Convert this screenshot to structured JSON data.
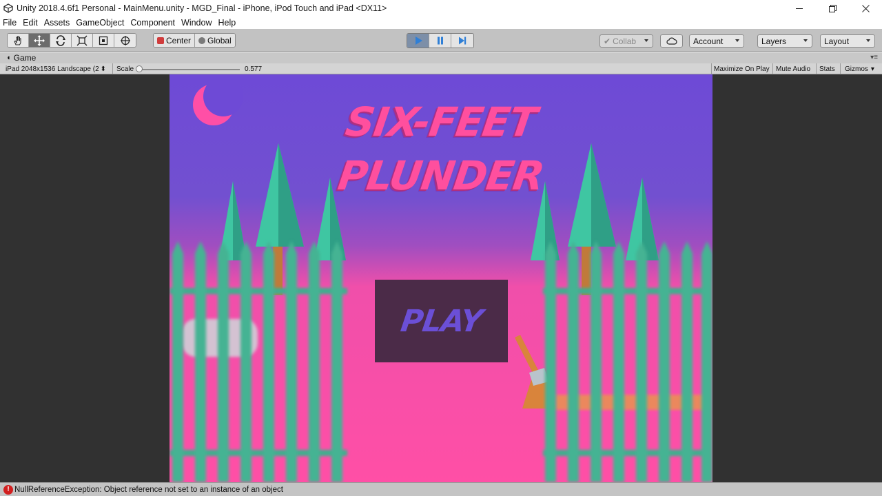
{
  "window": {
    "title": "Unity 2018.4.6f1 Personal - MainMenu.unity - MGD_Final - iPhone, iPod Touch and iPad <DX11>",
    "minimize_icon": "minimize-icon",
    "restore_icon": "restore-icon",
    "close_icon": "close-icon"
  },
  "menubar": {
    "items": [
      "File",
      "Edit",
      "Assets",
      "GameObject",
      "Component",
      "Window",
      "Help"
    ]
  },
  "toolbar": {
    "tools": [
      "hand-tool-icon",
      "move-tool-icon",
      "rotate-tool-icon",
      "scale-tool-icon",
      "rect-tool-icon",
      "transform-tool-icon"
    ],
    "active_tool": "move-tool-icon",
    "pivot_mode": "Center",
    "pivot_rotation": "Global",
    "play_state": "playing",
    "collab_label": "Collab",
    "account_label": "Account",
    "layers_label": "Layers",
    "layout_label": "Layout",
    "play_color": "#2f7fd6"
  },
  "game_view": {
    "tab_label": "Game",
    "resolution": "iPad 2048x1536 Landscape (2",
    "scale_label": "Scale",
    "scale_value": "0.577",
    "scale_fraction": 0.577,
    "maximize_on_play": "Maximize On Play",
    "mute_audio": "Mute Audio",
    "stats": "Stats",
    "gizmos": "Gizmos"
  },
  "game": {
    "title_line1": "SIX-FEET",
    "title_line2": "PLUNDER",
    "play_label": "PLAY",
    "colors": {
      "sky_top": "#6e4ad6",
      "sky_bottom": "#ff4fa6",
      "moon": "#ff4fa6",
      "title": "#ff4f9e",
      "play_panel": "#4b2b48",
      "play_text": "#6b4fd6",
      "fence": "#3fae8e",
      "trees": "#3fc6a2"
    }
  },
  "status": {
    "message": "NullReferenceException: Object reference not set to an instance of an object",
    "icon": "error-icon"
  }
}
